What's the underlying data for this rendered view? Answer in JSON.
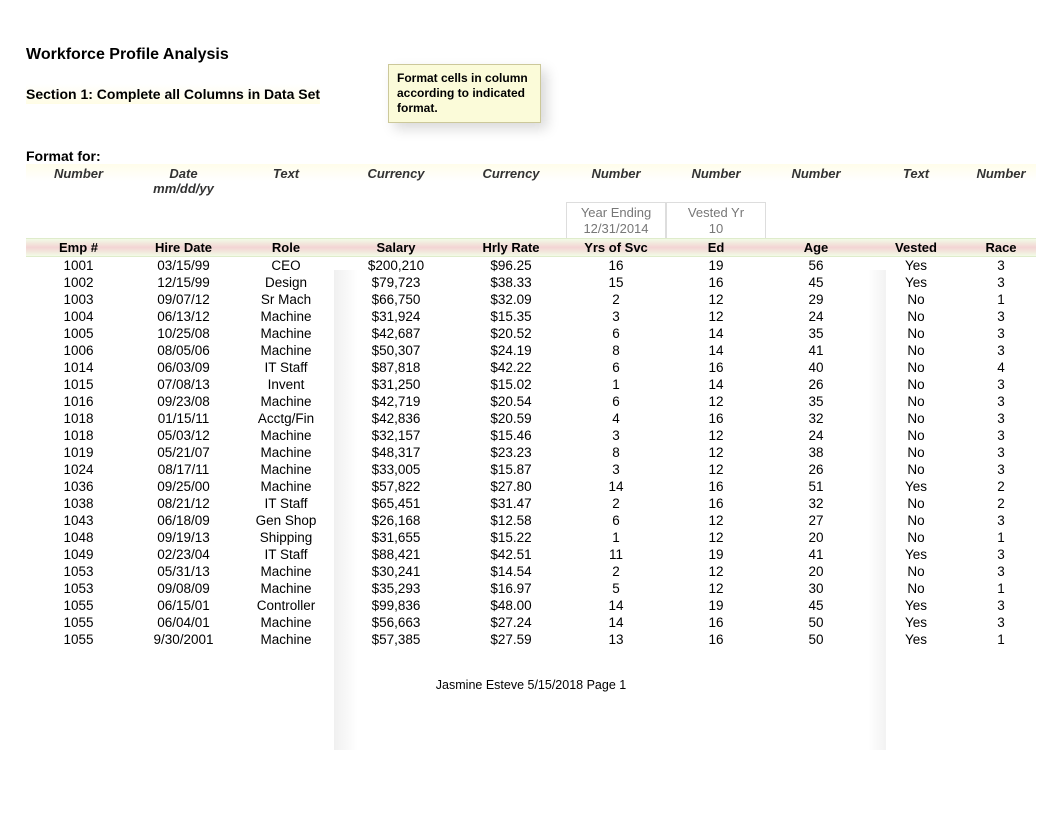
{
  "title": "Workforce Profile Analysis",
  "section_label": "Section 1: Complete all Columns in Data Set",
  "format_note": "Format cells in column according to indicated format.",
  "format_for_label": "Format for:",
  "format_types": [
    "Number",
    "Date",
    "Text",
    "Currency",
    "Currency",
    "Number",
    "Number",
    "Number",
    "Text",
    "Number"
  ],
  "date_fmt": "mm/dd/yy",
  "meta": {
    "yrs_lbl1": "Year Ending",
    "yrs_lbl2": "12/31/2014",
    "ed_lbl1": "Vested Yr",
    "ed_lbl2": "10"
  },
  "headers": [
    "Emp #",
    "Hire Date",
    "Role",
    "Salary",
    "Hrly Rate",
    "Yrs of Svc",
    "Ed",
    "Age",
    "Vested",
    "Race"
  ],
  "rows": [
    {
      "emp": "1001",
      "hire": "03/15/99",
      "role": "CEO",
      "salary": "$200,210",
      "rate": "$96.25",
      "yrs": "16",
      "ed": "19",
      "age": "56",
      "vested": "Yes",
      "race": "3"
    },
    {
      "emp": "1002",
      "hire": "12/15/99",
      "role": "Design",
      "salary": "$79,723",
      "rate": "$38.33",
      "yrs": "15",
      "ed": "16",
      "age": "45",
      "vested": "Yes",
      "race": "3"
    },
    {
      "emp": "1003",
      "hire": "09/07/12",
      "role": "Sr Mach",
      "salary": "$66,750",
      "rate": "$32.09",
      "yrs": "2",
      "ed": "12",
      "age": "29",
      "vested": "No",
      "race": "1"
    },
    {
      "emp": "1004",
      "hire": "06/13/12",
      "role": "Machine",
      "salary": "$31,924",
      "rate": "$15.35",
      "yrs": "3",
      "ed": "12",
      "age": "24",
      "vested": "No",
      "race": "3"
    },
    {
      "emp": "1005",
      "hire": "10/25/08",
      "role": "Machine",
      "salary": "$42,687",
      "rate": "$20.52",
      "yrs": "6",
      "ed": "14",
      "age": "35",
      "vested": "No",
      "race": "3"
    },
    {
      "emp": "1006",
      "hire": "08/05/06",
      "role": "Machine",
      "salary": "$50,307",
      "rate": "$24.19",
      "yrs": "8",
      "ed": "14",
      "age": "41",
      "vested": "No",
      "race": "3"
    },
    {
      "emp": "1014",
      "hire": "06/03/09",
      "role": "IT Staff",
      "salary": "$87,818",
      "rate": "$42.22",
      "yrs": "6",
      "ed": "16",
      "age": "40",
      "vested": "No",
      "race": "4"
    },
    {
      "emp": "1015",
      "hire": "07/08/13",
      "role": "Invent",
      "salary": "$31,250",
      "rate": "$15.02",
      "yrs": "1",
      "ed": "14",
      "age": "26",
      "vested": "No",
      "race": "3"
    },
    {
      "emp": "1016",
      "hire": "09/23/08",
      "role": "Machine",
      "salary": "$42,719",
      "rate": "$20.54",
      "yrs": "6",
      "ed": "12",
      "age": "35",
      "vested": "No",
      "race": "3"
    },
    {
      "emp": "1018",
      "hire": "01/15/11",
      "role": "Acctg/Fin",
      "salary": "$42,836",
      "rate": "$20.59",
      "yrs": "4",
      "ed": "16",
      "age": "32",
      "vested": "No",
      "race": "3"
    },
    {
      "emp": "1018",
      "hire": "05/03/12",
      "role": "Machine",
      "salary": "$32,157",
      "rate": "$15.46",
      "yrs": "3",
      "ed": "12",
      "age": "24",
      "vested": "No",
      "race": "3"
    },
    {
      "emp": "1019",
      "hire": "05/21/07",
      "role": "Machine",
      "salary": "$48,317",
      "rate": "$23.23",
      "yrs": "8",
      "ed": "12",
      "age": "38",
      "vested": "No",
      "race": "3"
    },
    {
      "emp": "1024",
      "hire": "08/17/11",
      "role": "Machine",
      "salary": "$33,005",
      "rate": "$15.87",
      "yrs": "3",
      "ed": "12",
      "age": "26",
      "vested": "No",
      "race": "3"
    },
    {
      "emp": "1036",
      "hire": "09/25/00",
      "role": "Machine",
      "salary": "$57,822",
      "rate": "$27.80",
      "yrs": "14",
      "ed": "16",
      "age": "51",
      "vested": "Yes",
      "race": "2"
    },
    {
      "emp": "1038",
      "hire": "08/21/12",
      "role": "IT Staff",
      "salary": "$65,451",
      "rate": "$31.47",
      "yrs": "2",
      "ed": "16",
      "age": "32",
      "vested": "No",
      "race": "2"
    },
    {
      "emp": "1043",
      "hire": "06/18/09",
      "role": "Gen Shop",
      "salary": "$26,168",
      "rate": "$12.58",
      "yrs": "6",
      "ed": "12",
      "age": "27",
      "vested": "No",
      "race": "3"
    },
    {
      "emp": "1048",
      "hire": "09/19/13",
      "role": "Shipping",
      "salary": "$31,655",
      "rate": "$15.22",
      "yrs": "1",
      "ed": "12",
      "age": "20",
      "vested": "No",
      "race": "1"
    },
    {
      "emp": "1049",
      "hire": "02/23/04",
      "role": "IT Staff",
      "salary": "$88,421",
      "rate": "$42.51",
      "yrs": "11",
      "ed": "19",
      "age": "41",
      "vested": "Yes",
      "race": "3"
    },
    {
      "emp": "1053",
      "hire": "05/31/13",
      "role": "Machine",
      "salary": "$30,241",
      "rate": "$14.54",
      "yrs": "2",
      "ed": "12",
      "age": "20",
      "vested": "No",
      "race": "3"
    },
    {
      "emp": "1053",
      "hire": "09/08/09",
      "role": "Machine",
      "salary": "$35,293",
      "rate": "$16.97",
      "yrs": "5",
      "ed": "12",
      "age": "30",
      "vested": "No",
      "race": "1"
    },
    {
      "emp": "1055",
      "hire": "06/15/01",
      "role": "Controller",
      "salary": "$99,836",
      "rate": "$48.00",
      "yrs": "14",
      "ed": "19",
      "age": "45",
      "vested": "Yes",
      "race": "3"
    },
    {
      "emp": "1055",
      "hire": "06/04/01",
      "role": "Machine",
      "salary": "$56,663",
      "rate": "$27.24",
      "yrs": "14",
      "ed": "16",
      "age": "50",
      "vested": "Yes",
      "race": "3"
    },
    {
      "emp": "1055",
      "hire": "9/30/2001",
      "role": "Machine",
      "salary": "$57,385",
      "rate": "$27.59",
      "yrs": "13",
      "ed": "16",
      "age": "50",
      "vested": "Yes",
      "race": "1"
    }
  ],
  "footer": "Jasmine Esteve 5/15/2018  Page 1"
}
